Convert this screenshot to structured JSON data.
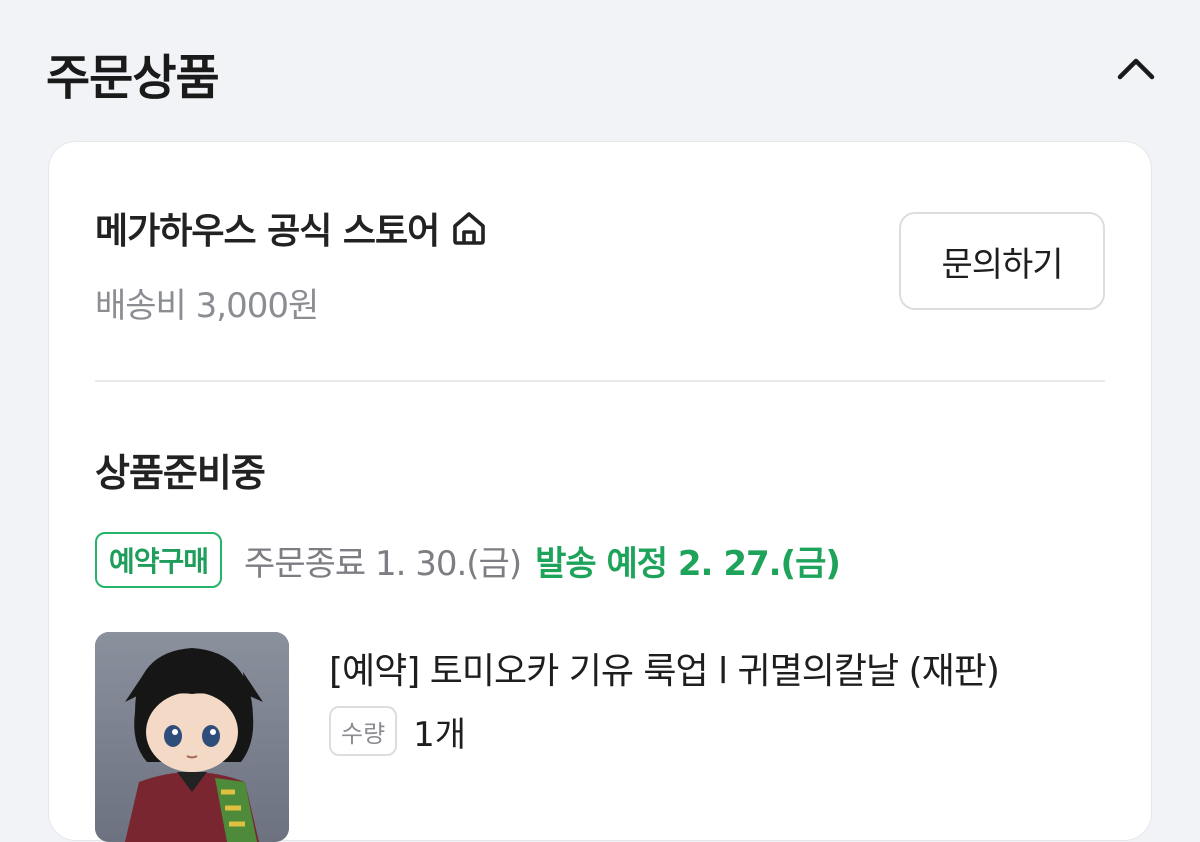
{
  "section": {
    "title": "주문상품",
    "collapse_icon": "chevron-up-icon"
  },
  "store": {
    "name": "메가하우스 공식 스토어",
    "home_icon": "home-icon",
    "shipping_fee": "배송비 3,000원",
    "inquiry_label": "문의하기"
  },
  "order": {
    "status": "상품준비중",
    "preorder_badge": "예약구매",
    "order_end": "주문종료 1. 30.(금)",
    "ship_date": "발송 예정 2. 27.(금)",
    "accent_color": "#1ea35a"
  },
  "product": {
    "name": "[예약] 토미오카 기유 룩업 l 귀멸의칼날 (재판)",
    "qty_label": "수량",
    "qty_value": "1개"
  }
}
